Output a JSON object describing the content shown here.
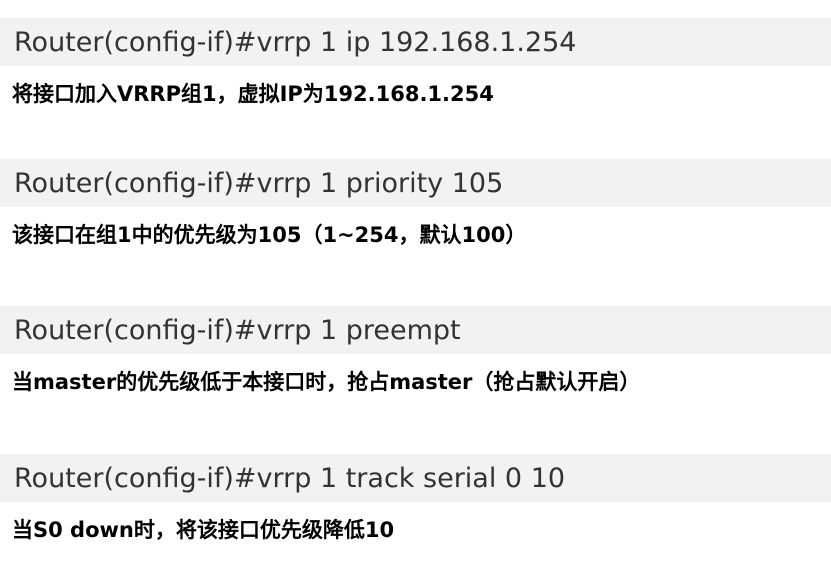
{
  "entries": [
    {
      "command": "Router(config-if)#vrrp 1 ip 192.168.1.254",
      "description": "将接口加入VRRP组1，虚拟IP为192.168.1.254"
    },
    {
      "command": "Router(config-if)#vrrp 1 priority 105",
      "description": "该接口在组1中的优先级为105（1~254，默认100）"
    },
    {
      "command": "Router(config-if)#vrrp 1 preempt",
      "description": "当master的优先级低于本接口时，抢占master（抢占默认开启）"
    },
    {
      "command": "Router(config-if)#vrrp 1 track serial 0 10",
      "description": "当S0 down时，将该接口优先级降低10"
    }
  ],
  "colors": {
    "command_bg": "#f2f2f2",
    "command_text": "#333333",
    "description_text": "#000000"
  }
}
